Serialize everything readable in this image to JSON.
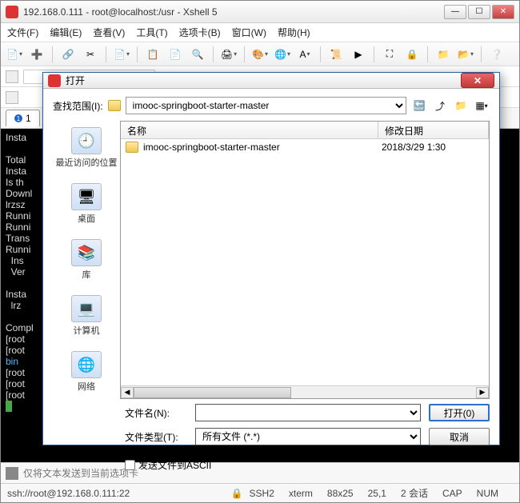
{
  "main": {
    "title": "192.168.0.111 - root@localhost:/usr - Xshell 5",
    "menu": [
      "文件(F)",
      "编辑(E)",
      "查看(V)",
      "工具(T)",
      "选项卡(B)",
      "窗口(W)",
      "帮助(H)"
    ],
    "tab_badge": "1",
    "tab_label": "1",
    "addr_hint": "",
    "cmd_placeholder": "仅将文本发送到当前选项卡",
    "terminal_lines": [
      "Insta",
      "",
      "Total",
      "Insta",
      "Is th",
      "Downl",
      "lrzsz",
      "Runni",
      "Runni",
      "Trans",
      "Runni",
      "  Ins",
      "  Ver",
      "",
      "Insta",
      "  lrz",
      "",
      "Compl",
      "[root",
      "[root",
      "bin  ",
      "[root",
      "[root",
      "[root"
    ],
    "status": {
      "left": "ssh://root@192.168.0.111:22",
      "s1": "SSH2",
      "s2": "xterm",
      "s3": "88x25",
      "s4": "25,1",
      "s5": "2 会话",
      "caps": "CAP",
      "num": "NUM"
    }
  },
  "dialog": {
    "title": "打开",
    "lookup_label": "查找范围(I):",
    "lookup_value": "imooc-springboot-starter-master",
    "places": [
      {
        "label": "最近访问的位置",
        "glyph": "🕘"
      },
      {
        "label": "桌面",
        "glyph": "🖥"
      },
      {
        "label": "库",
        "glyph": "📚"
      },
      {
        "label": "计算机",
        "glyph": "💻"
      },
      {
        "label": "网络",
        "glyph": "🌐"
      }
    ],
    "cols": {
      "name": "名称",
      "date": "修改日期"
    },
    "rows": [
      {
        "name": "imooc-springboot-starter-master",
        "date": "2018/3/29 1:30"
      }
    ],
    "filename_label": "文件名(N):",
    "filename_value": "",
    "filetype_label": "文件类型(T):",
    "filetype_value": "所有文件 (*.*)",
    "open_btn": "打开(0)",
    "cancel_btn": "取消",
    "ascii_label": "发送文件到ASCII"
  }
}
